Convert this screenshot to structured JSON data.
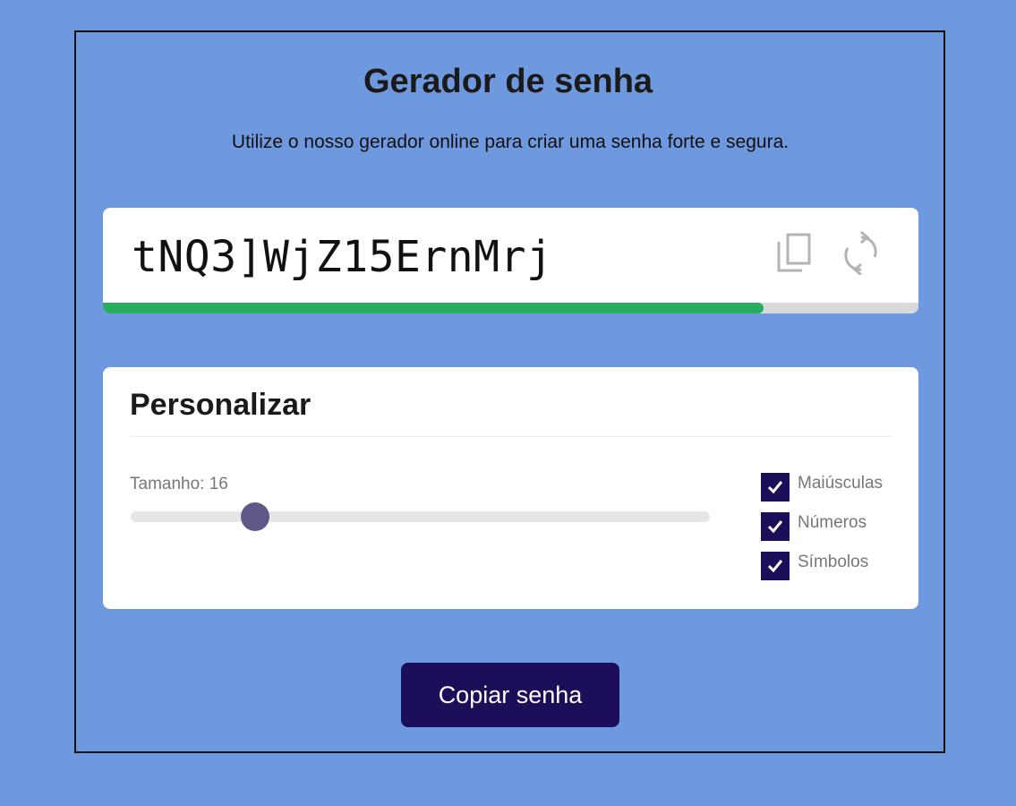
{
  "page": {
    "title": "Gerador de senha",
    "subtitle": "Utilize o nosso gerador online para criar uma senha forte e segura."
  },
  "password": {
    "value": "tNQ3]WjZ15ErnMrj",
    "strength_fraction": 0.81,
    "strength_color": "#27ae60",
    "copy_icon": "copy-icon",
    "refresh_icon": "refresh-icon"
  },
  "customize": {
    "title": "Personalizar",
    "length_label": "Tamanho: 16",
    "slider_value_fraction": 0.215,
    "options": [
      {
        "label": "Maiúsculas",
        "checked": true
      },
      {
        "label": "Números",
        "checked": true
      },
      {
        "label": "Símbolos",
        "checked": true
      }
    ]
  },
  "copy_button": {
    "label": "Copiar senha"
  },
  "colors": {
    "background": "#6f99df",
    "accent": "#1c0e58",
    "slider_thumb": "#5f5888"
  }
}
